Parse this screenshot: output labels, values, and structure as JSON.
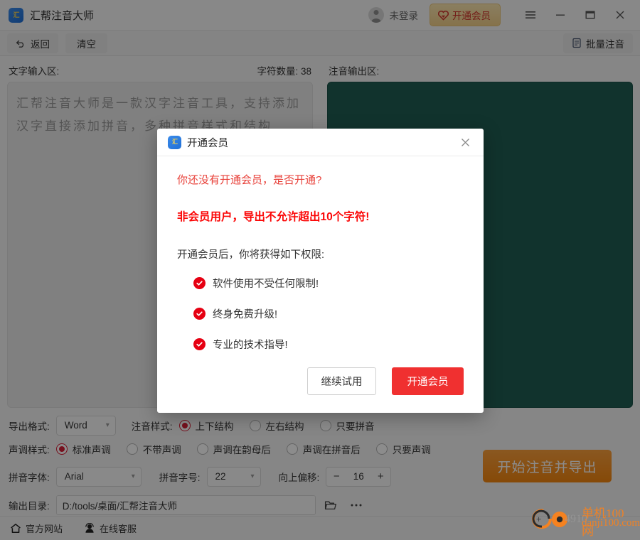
{
  "titlebar": {
    "app_title": "汇帮注音大师",
    "app_icon": "app-logo-icon",
    "account_label": "未登录",
    "vip_button_label": "开通会员",
    "menu_icon": "hamburger-menu-icon",
    "minimize_icon": "minimize-icon",
    "maximize_icon": "maximize-icon",
    "close_icon": "close-icon"
  },
  "toolbar": {
    "back_label": "返回",
    "clear_label": "清空",
    "batch_label": "批量注音"
  },
  "input_pane": {
    "title": "文字输入区:",
    "char_count_label": "字符数量: 38",
    "text": "汇帮注音大师是一款汉字注音工具，支持添加汉字直接添加拼音，多种拼音样式和结构"
  },
  "output_pane": {
    "title": "注音输出区:",
    "background_color": "#1f5d52",
    "text": ""
  },
  "settings": {
    "export_format": {
      "label": "导出格式:",
      "value": "Word"
    },
    "phonetic_style": {
      "label": "注音样式:",
      "options": [
        "上下结构",
        "左右结构",
        "只要拼音"
      ],
      "selected": "上下结构"
    },
    "tone_style": {
      "label": "声调样式:",
      "options": [
        "标准声调",
        "不带声调",
        "声调在韵母后",
        "声调在拼音后",
        "只要声调"
      ],
      "selected": "标准声调"
    },
    "pinyin_font": {
      "label": "拼音字体:",
      "value": "Arial"
    },
    "pinyin_size": {
      "label": "拼音字号:",
      "value": "22"
    },
    "offset_up": {
      "label": "向上偏移:",
      "value": "16",
      "minus_label": "−",
      "plus_label": "+"
    },
    "output_dir": {
      "label": "输出目录:",
      "value": "D:/tools/桌面/汇帮注音大师",
      "folder_icon": "folder-open-icon",
      "more_icon": "more-ellipsis-icon"
    },
    "start_button_label": "开始注音并导出",
    "start_button_color": "#f4860f"
  },
  "statusbar": {
    "website_label": "官方网站",
    "website_icon": "home-icon",
    "support_label": "在线客服",
    "support_icon": "headset-person-icon"
  },
  "watermark": {
    "line1": "单机100网",
    "line2": "danji100.com",
    "middle": "4910",
    "color": "#f58220"
  },
  "modal": {
    "icon": "app-logo-icon",
    "title": "开通会员",
    "close_icon": "close-icon",
    "question": "你还没有开通会员，是否开通?",
    "warning": "非会员用户，导出不允许超出10个字符!",
    "benefits_intro": "开通会员后，你将获得如下权限:",
    "benefits": [
      "软件使用不受任何限制!",
      "终身免费升级!",
      "专业的技术指导!"
    ],
    "secondary_button": "继续试用",
    "primary_button": "开通会员",
    "primary_color": "#f03030",
    "warning_color": "#fb0606",
    "question_color": "#e8413a"
  }
}
